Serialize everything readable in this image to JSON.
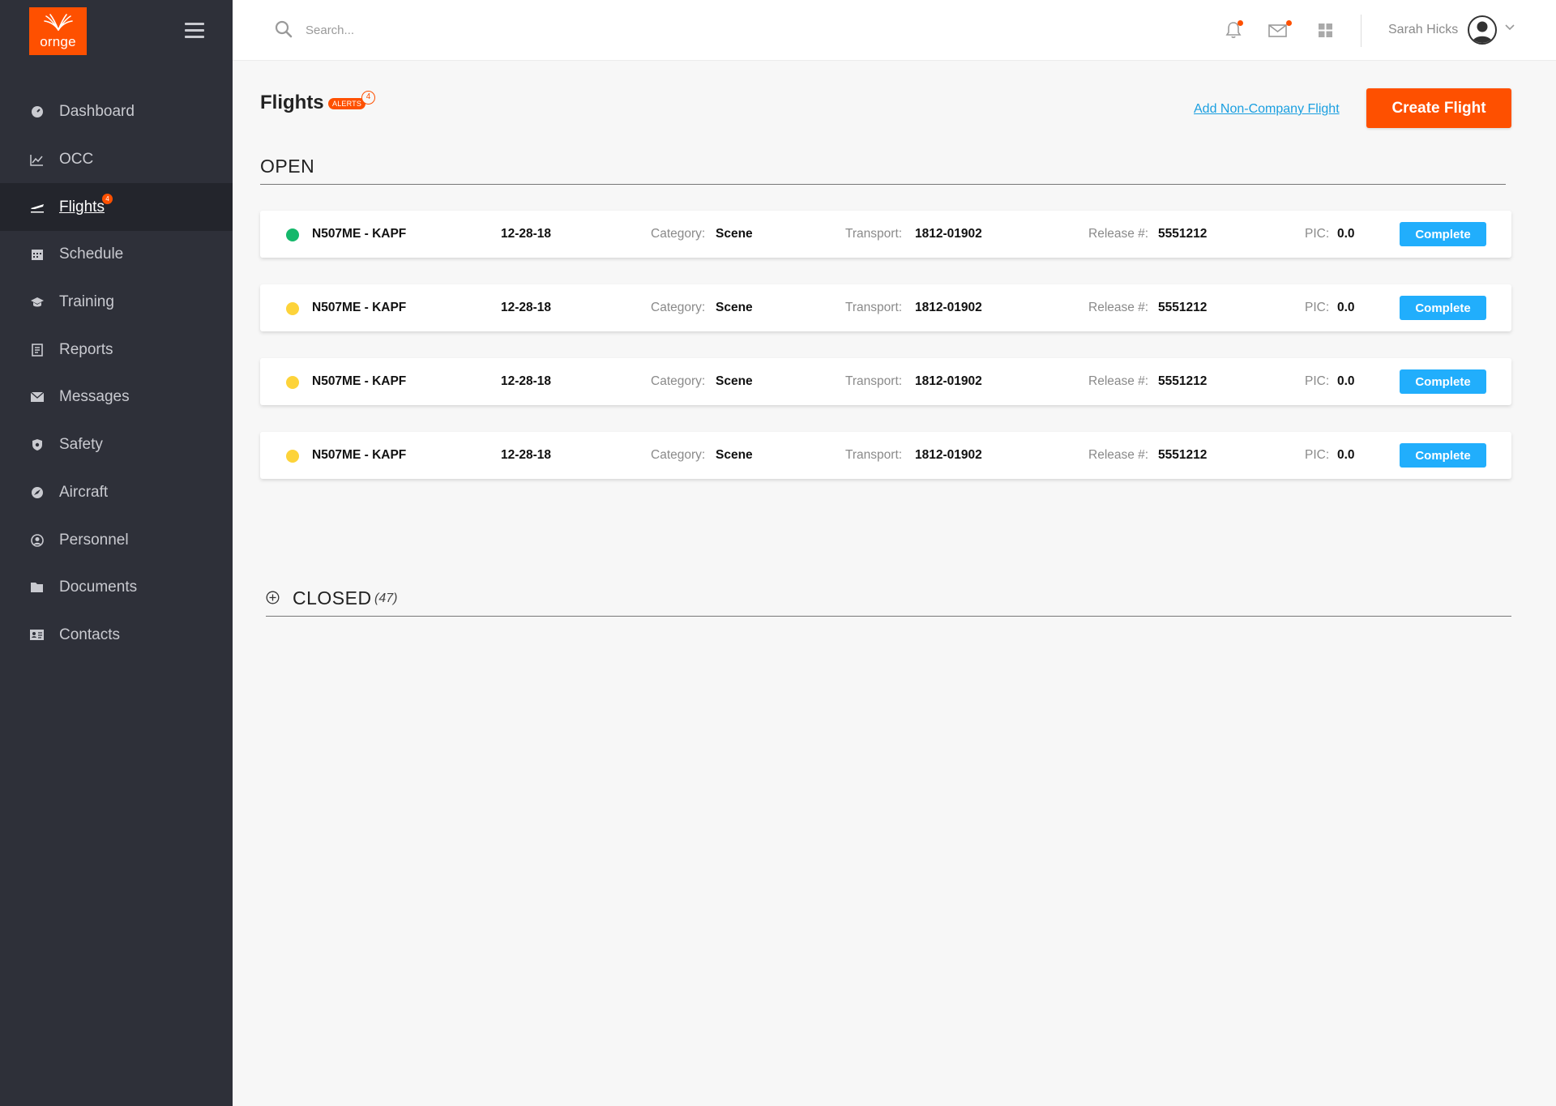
{
  "app": {
    "logo_text": "ornge",
    "brand_color": "#fe5000",
    "accent_color": "#21aefc"
  },
  "sidebar": {
    "menu_icon": "hamburger-icon",
    "items": [
      {
        "label": "Dashboard",
        "icon": "dashboard-icon"
      },
      {
        "label": "OCC",
        "icon": "line-chart-icon"
      },
      {
        "label": "Flights",
        "icon": "plane-icon",
        "active": true,
        "badge": "4"
      },
      {
        "label": "Schedule",
        "icon": "calendar-icon"
      },
      {
        "label": "Training",
        "icon": "graduation-cap-icon"
      },
      {
        "label": "Reports",
        "icon": "report-icon"
      },
      {
        "label": "Messages",
        "icon": "envelope-icon"
      },
      {
        "label": "Safety",
        "icon": "shield-icon"
      },
      {
        "label": "Aircraft",
        "icon": "compass-icon"
      },
      {
        "label": "Personnel",
        "icon": "user-circle-icon"
      },
      {
        "label": "Documents",
        "icon": "folder-icon"
      },
      {
        "label": "Contacts",
        "icon": "address-card-icon"
      }
    ]
  },
  "topbar": {
    "search_placeholder": "Search...",
    "user_name": "Sarah Hicks"
  },
  "main": {
    "title": "Flights",
    "alerts_label": "ALERTS",
    "alerts_count": "4",
    "add_link": "Add Non-Company Flight",
    "create_button": "Create Flight",
    "open_label": "OPEN",
    "closed_label": "CLOSED",
    "closed_count": "(47)",
    "field_labels": {
      "category": "Category:",
      "transport": "Transport:",
      "release": "Release #:",
      "pic": "PIC:"
    },
    "flights": [
      {
        "id": "N507ME - KAPF",
        "date": "12-28-18",
        "category": "Scene",
        "transport": "1812-01902",
        "release": "5551212",
        "pic": "0.0",
        "status_color": "#15b86b",
        "action": "Complete"
      },
      {
        "id": "N507ME - KAPF",
        "date": "12-28-18",
        "category": "Scene",
        "transport": "1812-01902",
        "release": "5551212",
        "pic": "0.0",
        "status_color": "#fdd33a",
        "action": "Complete"
      },
      {
        "id": "N507ME - KAPF",
        "date": "12-28-18",
        "category": "Scene",
        "transport": "1812-01902",
        "release": "5551212",
        "pic": "0.0",
        "status_color": "#fdd33a",
        "action": "Complete"
      },
      {
        "id": "N507ME - KAPF",
        "date": "12-28-18",
        "category": "Scene",
        "transport": "1812-01902",
        "release": "5551212",
        "pic": "0.0",
        "status_color": "#fdd33a",
        "action": "Complete"
      }
    ]
  }
}
